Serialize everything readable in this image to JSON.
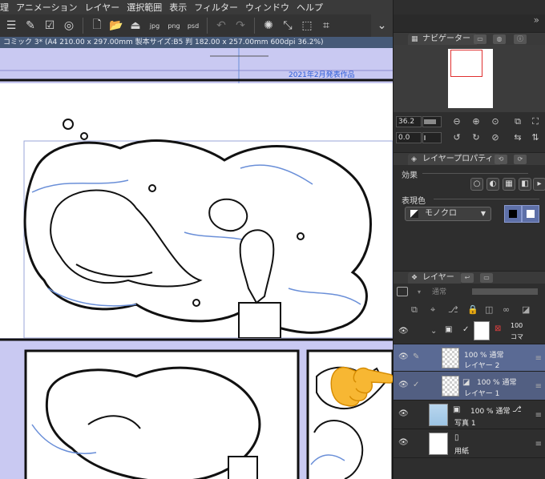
{
  "menu": {
    "items": [
      "理",
      "アニメーション",
      "レイヤー",
      "選択範囲",
      "表示",
      "フィルター",
      "ウィンドウ",
      "ヘルプ"
    ]
  },
  "toolbar": {
    "icons": [
      "menu-icon",
      "pen-settings-icon",
      "layer-check-icon",
      "spiral-icon",
      "new-file-icon",
      "open-folder-icon",
      "save-icon",
      "export-jpg-icon",
      "export-png-icon",
      "export-psd-icon",
      "undo-icon",
      "redo-icon",
      "loading-icon",
      "transform-icon",
      "select-all-icon",
      "crop-icon"
    ],
    "jpg": "jpg",
    "png": "png",
    "psd": "psd"
  },
  "document": {
    "tab_title": "コミック 3* (A4 210.00 x 297.00mm 製本サイズ:B5 判 182.00 x 257.00mm 600dpi 36.2%)"
  },
  "canvas": {
    "blue_text": "2021年2月発表作品"
  },
  "navigator": {
    "title": "ナビゲーター",
    "zoom": "36.2",
    "rotation": "0.0",
    "zoom_fill": 0.75,
    "rotation_fill": 0.05
  },
  "layer_property": {
    "title": "レイヤープロパティ",
    "effect_label": "効果",
    "expression_label": "表現色",
    "expression_value": "モノクロ"
  },
  "layer_panel": {
    "title": "レイヤー",
    "blend_mode": "通常",
    "opacity_fill": 1.0,
    "layers": [
      {
        "name": "",
        "opacity": "100",
        "mode": "コマ",
        "kind": "folder"
      },
      {
        "name": "レイヤー 2",
        "opacity": "100 %",
        "mode": "通常",
        "kind": "raster"
      },
      {
        "name": "レイヤー 1",
        "opacity": "100 %",
        "mode": "通常",
        "kind": "raster"
      },
      {
        "name": "写真 1",
        "opacity": "100 %",
        "mode": "通常",
        "kind": "photo"
      },
      {
        "name": "用紙",
        "opacity": "",
        "mode": "",
        "kind": "paper"
      }
    ]
  },
  "colors": {
    "selected_layer": "#5a6a94",
    "canvas_bg": "#c9c9f2",
    "accent_blue": "#6a8fd8"
  }
}
